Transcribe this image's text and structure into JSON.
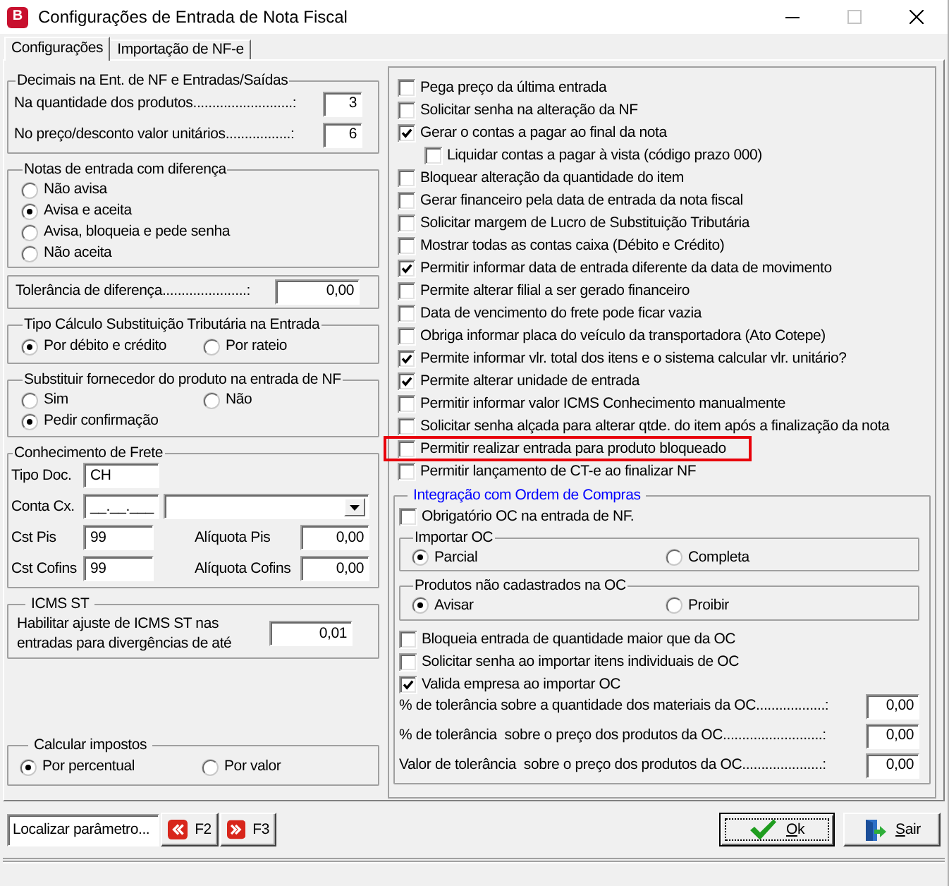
{
  "window": {
    "icon_letter": "B",
    "title": "Configurações de Entrada de Nota Fiscal",
    "controls": [
      {
        "kind": "minimize",
        "disabled": false
      },
      {
        "kind": "maximize",
        "disabled": true
      },
      {
        "kind": "close",
        "disabled": false
      }
    ]
  },
  "tabs": [
    {
      "label": "Configurações",
      "selected": true
    },
    {
      "label": "Importação de NF-e",
      "selected": false
    }
  ],
  "decimals": {
    "title": "Decimais na Ent. de NF e Entradas/Saídas",
    "fields": [
      {
        "label": "Na quantidade dos produtos..........................:",
        "value": "3"
      },
      {
        "label": "No preço/desconto valor unitários.................:",
        "value": "6"
      }
    ]
  },
  "entry_differences": {
    "title": "Notas de entrada com diferença",
    "options": [
      {
        "label": "Não avisa",
        "selected": false
      },
      {
        "label": "Avisa e aceita",
        "selected": true
      },
      {
        "label": "Avisa, bloqueia e pede senha",
        "selected": false
      },
      {
        "label": "Não aceita",
        "selected": false
      }
    ]
  },
  "difference_tolerance": {
    "label": "Tolerância de diferença......................:",
    "value": "0,00"
  },
  "st_calculation": {
    "title": "Tipo Cálculo Substituição Tributária na Entrada",
    "options": [
      {
        "label": "Por débito e crédito",
        "selected": true
      },
      {
        "label": "Por rateio",
        "selected": false
      }
    ]
  },
  "replace_supplier": {
    "title": "Substituir fornecedor do produto na entrada de NF",
    "options": [
      {
        "label": "Sim",
        "selected": false
      },
      {
        "label": "Não",
        "selected": false
      },
      {
        "label": "Pedir confirmação",
        "selected": true
      }
    ]
  },
  "freight": {
    "title": "Conhecimento de Frete",
    "doc_type": {
      "label": "Tipo Doc.",
      "value": "CH"
    },
    "cash_account": {
      "label": "Conta Cx.",
      "value": "__.__.___"
    },
    "taxes": [
      {
        "cst_label": "Cst Pis",
        "cst_value": "99",
        "rate_label": "Alíquota Pis",
        "rate_value": "0,00"
      },
      {
        "cst_label": "Cst Cofins",
        "cst_value": "99",
        "rate_label": "Alíquota Cofins",
        "rate_value": "0,00"
      }
    ]
  },
  "icms_st": {
    "title": "ICMS ST",
    "label": "Habilitar ajuste de ICMS ST nas entradas para divergências de até",
    "value": "0,01"
  },
  "tax_calculation": {
    "title": "Calcular impostos",
    "options": [
      {
        "label": "Por percentual",
        "selected": true
      },
      {
        "label": "Por valor",
        "selected": false
      }
    ]
  },
  "options": [
    {
      "label": "Pega preço da última entrada",
      "checked": false,
      "highlighted": false
    },
    {
      "label": "Solicitar senha na alteração da NF",
      "checked": false,
      "highlighted": false
    },
    {
      "label": "Gerar o contas a pagar ao final da nota",
      "checked": true,
      "highlighted": false,
      "children": [
        {
          "label": "Liquidar contas a pagar à vista (código prazo 000)",
          "checked": false,
          "highlighted": false
        }
      ]
    },
    {
      "label": "Bloquear alteração da quantidade do item",
      "checked": false,
      "highlighted": false
    },
    {
      "label": "Gerar financeiro pela data de entrada da nota fiscal",
      "checked": false,
      "highlighted": false
    },
    {
      "label": "Solicitar margem de Lucro de Substituição Tributária",
      "checked": false,
      "highlighted": false
    },
    {
      "label": "Mostrar todas as contas caixa (Débito e Crédito)",
      "checked": false,
      "highlighted": false
    },
    {
      "label": "Permitir informar data de entrada diferente da data de movimento",
      "checked": true,
      "highlighted": false
    },
    {
      "label": "Permite alterar filial a ser gerado financeiro",
      "checked": false,
      "highlighted": false
    },
    {
      "label": "Data de vencimento do frete pode ficar vazia",
      "checked": false,
      "highlighted": false
    },
    {
      "label": "Obriga informar placa do veículo da transportadora (Ato Cotepe)",
      "checked": false,
      "highlighted": false
    },
    {
      "label": "Permite informar vlr. total dos itens e o sistema calcular vlr. unitário?",
      "checked": true,
      "highlighted": false
    },
    {
      "label": "Permite alterar unidade de entrada",
      "checked": true,
      "highlighted": false
    },
    {
      "label": "Permitir informar valor ICMS Conhecimento manualmente",
      "checked": false,
      "highlighted": false
    },
    {
      "label": "Solicitar senha alçada para alterar qtde. do item após a finalização da nota",
      "checked": false,
      "highlighted": false
    },
    {
      "label": "Permitir realizar entrada para produto bloqueado",
      "checked": false,
      "highlighted": true
    },
    {
      "label": "Permitir lançamento de CT-e ao finalizar NF",
      "checked": false,
      "highlighted": false
    }
  ],
  "purchase_orders": {
    "title": "Integração com Ordem de Compras",
    "required": {
      "label": "Obrigatório OC na entrada de NF.",
      "checked": false
    },
    "import_oc": {
      "title": "Importar OC",
      "options": [
        {
          "label": "Parcial",
          "selected": true
        },
        {
          "label": "Completa",
          "selected": false
        }
      ]
    },
    "unregistered_products": {
      "title": "Produtos não cadastrados na OC",
      "options": [
        {
          "label": "Avisar",
          "selected": true
        },
        {
          "label": "Proibir",
          "selected": false
        }
      ]
    },
    "checks": [
      {
        "label": "Bloqueia entrada de quantidade maior que da OC",
        "checked": false
      },
      {
        "label": "Solicitar senha ao importar itens individuais de OC",
        "checked": false
      },
      {
        "label": "Valida empresa ao importar OC",
        "checked": true
      }
    ],
    "tolerances": [
      {
        "label": "% de tolerância sobre a quantidade dos materiais da OC..................:",
        "value": "0,00"
      },
      {
        "label": "% de tolerância  sobre o preço dos produtos da OC..........................:",
        "value": "0,00"
      },
      {
        "label": "Valor de tolerância  sobre o preço dos produtos da OC.....................:",
        "value": "0,00"
      }
    ]
  },
  "footer": {
    "search": {
      "value": "Localizar parâmetro..."
    },
    "nav_buttons": [
      {
        "label": "F2",
        "kind": "previous"
      },
      {
        "label": "F3",
        "kind": "next"
      }
    ],
    "actions": [
      {
        "label": "Ok",
        "kind": "confirm",
        "default": true
      },
      {
        "label": "Sair",
        "kind": "exit",
        "default": false
      }
    ]
  }
}
